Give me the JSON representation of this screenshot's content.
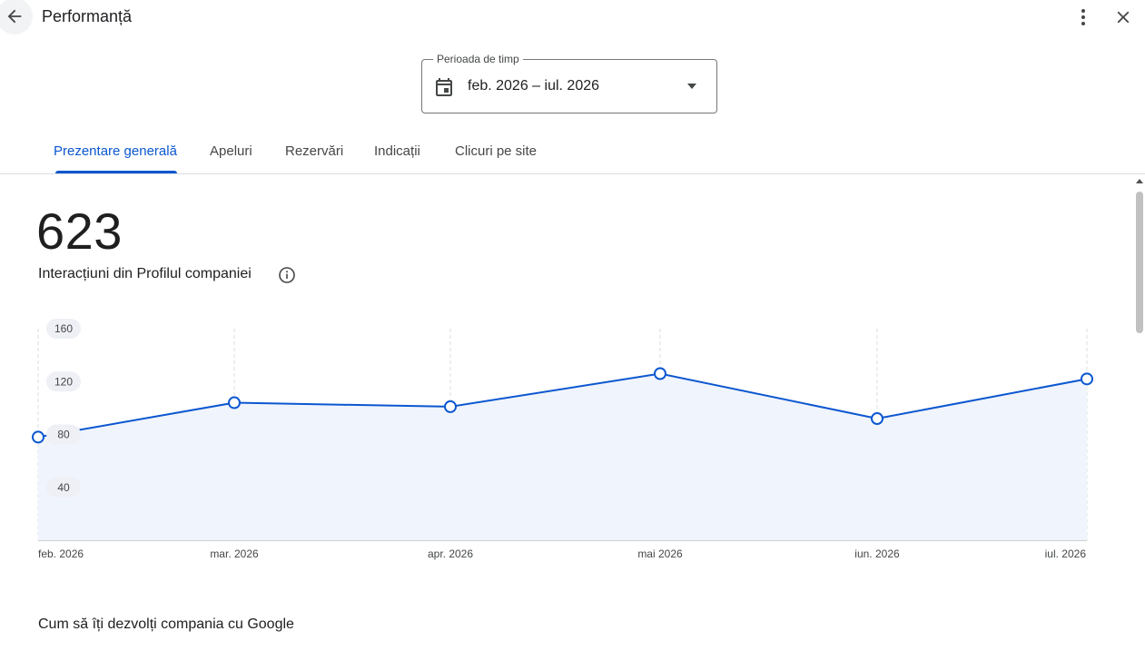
{
  "header": {
    "title": "Performanță"
  },
  "date_range": {
    "label": "Perioada de timp",
    "value": "feb. 2026 – iul. 2026"
  },
  "tabs": [
    {
      "label": "Prezentare generală",
      "active": true
    },
    {
      "label": "Apeluri",
      "active": false
    },
    {
      "label": "Rezervări",
      "active": false
    },
    {
      "label": "Indicații",
      "active": false
    },
    {
      "label": "Clicuri pe site",
      "active": false
    }
  ],
  "summary": {
    "total": "623",
    "label": "Interacțiuni din Profilul companiei"
  },
  "section": {
    "title": "Cum să îți dezvolți compania cu Google"
  },
  "colors": {
    "accent": "#0b57d0",
    "area_fill": "#f0f4fc"
  },
  "chart_data": {
    "type": "area",
    "categories": [
      "feb. 2026",
      "mar. 2026",
      "apr. 2026",
      "mai 2026",
      "iun. 2026",
      "iul. 2026"
    ],
    "values": [
      78,
      104,
      101,
      126,
      92,
      122
    ],
    "y_ticks": [
      40,
      80,
      120,
      160
    ],
    "ylim": [
      0,
      160
    ],
    "grid": "vertical-dashed",
    "legend": "none"
  }
}
